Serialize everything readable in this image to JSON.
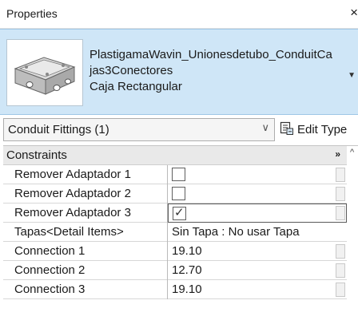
{
  "window": {
    "title": "Properties",
    "close_glyph": "×"
  },
  "type_selector": {
    "thumbnail_icon": "conduit-box-icon",
    "family_line1": "PlastigamaWavin_Unionesdetubo_ConduitCa",
    "family_line2": "jas3Conectores",
    "type_name": "Caja Rectangular"
  },
  "instance_filter": {
    "label": "Conduit Fittings (1)",
    "edit_type_label": "Edit Type"
  },
  "grid": {
    "category": "Constraints",
    "rows": [
      {
        "name": "Remover Adaptador 1",
        "kind": "checkbox",
        "checked": false,
        "value": ""
      },
      {
        "name": "Remover Adaptador 2",
        "kind": "checkbox",
        "checked": false,
        "value": ""
      },
      {
        "name": "Remover Adaptador 3",
        "kind": "checkbox",
        "checked": true,
        "value": ""
      },
      {
        "name": "Tapas<Detail Items>",
        "kind": "text",
        "checked": false,
        "value": "Sin Tapa : No usar Tapa"
      },
      {
        "name": "Connection 1",
        "kind": "text",
        "checked": false,
        "value": "19.10"
      },
      {
        "name": "Connection 2",
        "kind": "text",
        "checked": false,
        "value": "12.70"
      },
      {
        "name": "Connection 3",
        "kind": "text",
        "checked": false,
        "value": "19.10"
      }
    ]
  }
}
